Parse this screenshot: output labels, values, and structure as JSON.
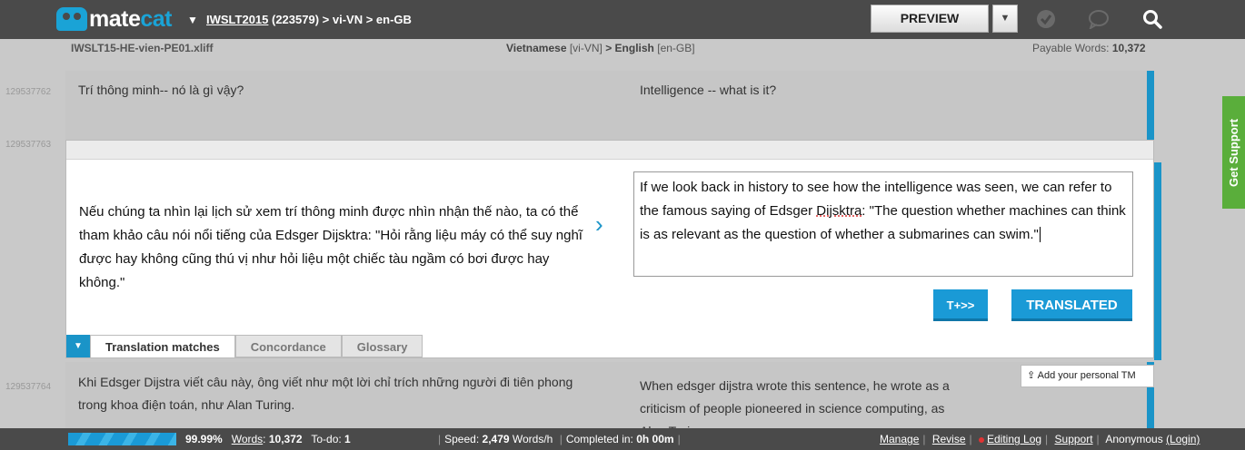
{
  "header": {
    "logo_a": "mate",
    "logo_b": "cat",
    "project_link": "IWSLT2015",
    "project_rest": " (223579) > vi-VN > en-GB",
    "preview_label": "PREVIEW"
  },
  "info": {
    "file": "IWSLT15-HE-vien-PE01.xliff",
    "lang_src": "Vietnamese",
    "lang_src_code": "[vi-VN]",
    "lang_sep": ">",
    "lang_tgt": "English",
    "lang_tgt_code": "[en-GB]",
    "payable_label": "Payable Words:",
    "payable_value": "10,372"
  },
  "segments": [
    {
      "id": "129537762",
      "source": "Trí thông minh-- nó là gì vậy?",
      "target": "Intelligence -- what is it?"
    },
    {
      "id": "129537763",
      "source": "Nếu chúng ta nhìn lại lịch sử xem trí thông minh được nhìn nhận thế nào, ta có thể tham khảo câu nói nổi tiếng của Edsger Dijsktra: \"Hỏi rằng liệu máy có thể suy nghĩ được hay không cũng thú vị như hỏi liệu một chiếc tàu ngầm có bơi được hay không.\"",
      "target_a": "If we look back in history to see how the intelligence was seen, we can refer to the famous saying of Edsger ",
      "target_sq": "Dijsktra",
      "target_b": ": \"The question whether machines can think is as relevant as the question of whether a submarines can swim.\""
    },
    {
      "id": "129537764",
      "source": "Khi Edsger Dijstra viết câu này, ông viết như một lời chỉ trích những người đi tiên phong trong khoa điện toán, như Alan Turing.",
      "target": "When edsger dijstra wrote this sentence, he wrote as a criticism of people pioneered in science computing, as Alan Turing."
    }
  ],
  "editor": {
    "tplus_label": "T+>>",
    "translated_label": "TRANSLATED",
    "tabs": [
      "Translation matches",
      "Concordance",
      "Glossary"
    ]
  },
  "tm_tip": "Add your personal TM",
  "support_label": "Get Support",
  "footer": {
    "progress_pct": "99.99%",
    "progress_fraction": 0.9999,
    "words_label": "Words",
    "words_value": "10,372",
    "todo_label": "To-do:",
    "todo_value": "1",
    "speed_label": "Speed:",
    "speed_value": "2,479",
    "speed_unit": "Words/h",
    "completed_label": "Completed in:",
    "completed_value": "0h 00m",
    "manage": "Manage",
    "revise": "Revise",
    "editing_log": "Editing Log",
    "support": "Support",
    "user": "Anonymous",
    "login": "(Login)"
  },
  "colors": {
    "accent": "#1a94c8",
    "topbar": "#4a4a4a",
    "support": "#5aae3b"
  }
}
